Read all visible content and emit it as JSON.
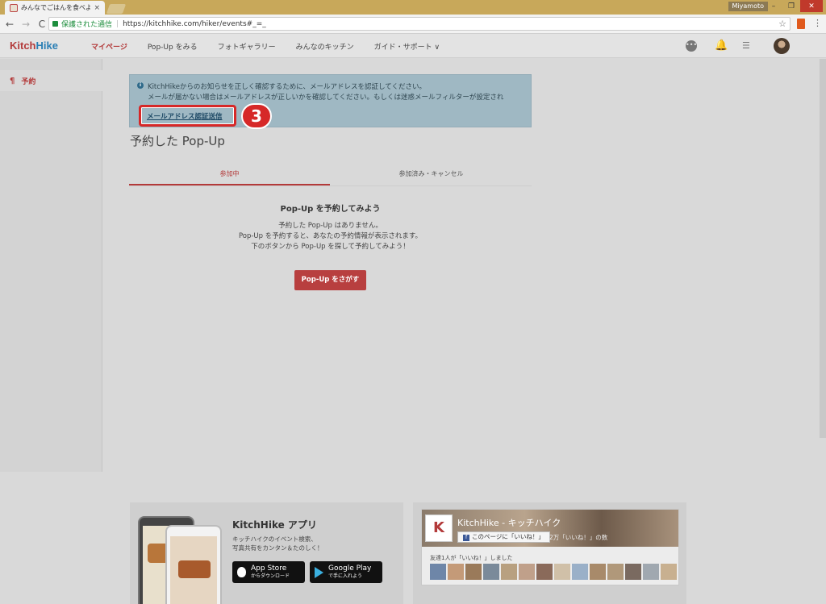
{
  "browser": {
    "tab_title": "みんなでごはんを食べよう主",
    "tab_close": "×",
    "user_badge": "Miyamoto",
    "win_min": "–",
    "win_max": "❐",
    "win_close": "✕",
    "back": "←",
    "forward": "→",
    "reload": "C",
    "secure_text": "保護された通信",
    "url_sep": "|",
    "url": "https://kitchhike.com/hiker/events#_=_",
    "star": "☆",
    "menu": "⋮"
  },
  "header": {
    "logo_part1": "Kitch",
    "logo_part2": "Hike",
    "nav": [
      {
        "label": "マイページ"
      },
      {
        "label": "Pop-Up をみる"
      },
      {
        "label": "フォトギャラリー"
      },
      {
        "label": "みんなのキッチン"
      },
      {
        "label": "ガイド・サポート ∨"
      }
    ],
    "chat_glyph": "•••",
    "bell_glyph": "🔔",
    "todo_glyph": "☰"
  },
  "sidebar": {
    "items": [
      {
        "icon": "¶",
        "label": "予約"
      }
    ]
  },
  "alert": {
    "info_glyph": "i",
    "line1": "KitchHikeからのお知らせを正しく確認するために、メールアドレスを認証してください。",
    "line2": "メールが届かない場合はメールアドレスが正しいかを確認してください。もしくは迷惑メールフィルターが設定され",
    "link": "メールアドレス認証送信"
  },
  "annotation": {
    "step": "3"
  },
  "main": {
    "title": "予約した Pop-Up",
    "tabs": [
      {
        "label": "参加中"
      },
      {
        "label": "参加済み・キャンセル"
      }
    ],
    "empty_title": "Pop-Up を予約してみよう",
    "empty_lines": [
      "予約した Pop-Up はありません。",
      "Pop-Up を予約すると、あなたの予約情報が表示されます。",
      "下のボタンから Pop-Up を探して予約してみよう！"
    ],
    "find_button": "Pop-Up をさがす"
  },
  "footer": {
    "app_title": "KitchHike アプリ",
    "app_desc1": "キッチハイクのイベント検索、",
    "app_desc2": "写真共有をカンタン＆たのしく！",
    "appstore_big": "App Store",
    "appstore_small": "からダウンロード",
    "googleplay_big": "Google Play",
    "googleplay_small": "で手に入れよう",
    "fb_logo": "K",
    "fb_name": "KitchHike - キッチハイク",
    "fb_like_f": "f",
    "fb_like": "このページに「いいね！」",
    "fb_count": "2万「いいね！」の数",
    "fb_friends": "友達1人が「いいね！」しました",
    "face_colors": [
      "#6e86a8",
      "#c49a78",
      "#9a7a5a",
      "#7a8a9a",
      "#b8a080",
      "#c0a08a",
      "#8a6a5a",
      "#d0c0a8",
      "#9ab0c8",
      "#a88a6a",
      "#b0987a",
      "#7a6a60",
      "#a0a8b0",
      "#c8b090"
    ]
  }
}
